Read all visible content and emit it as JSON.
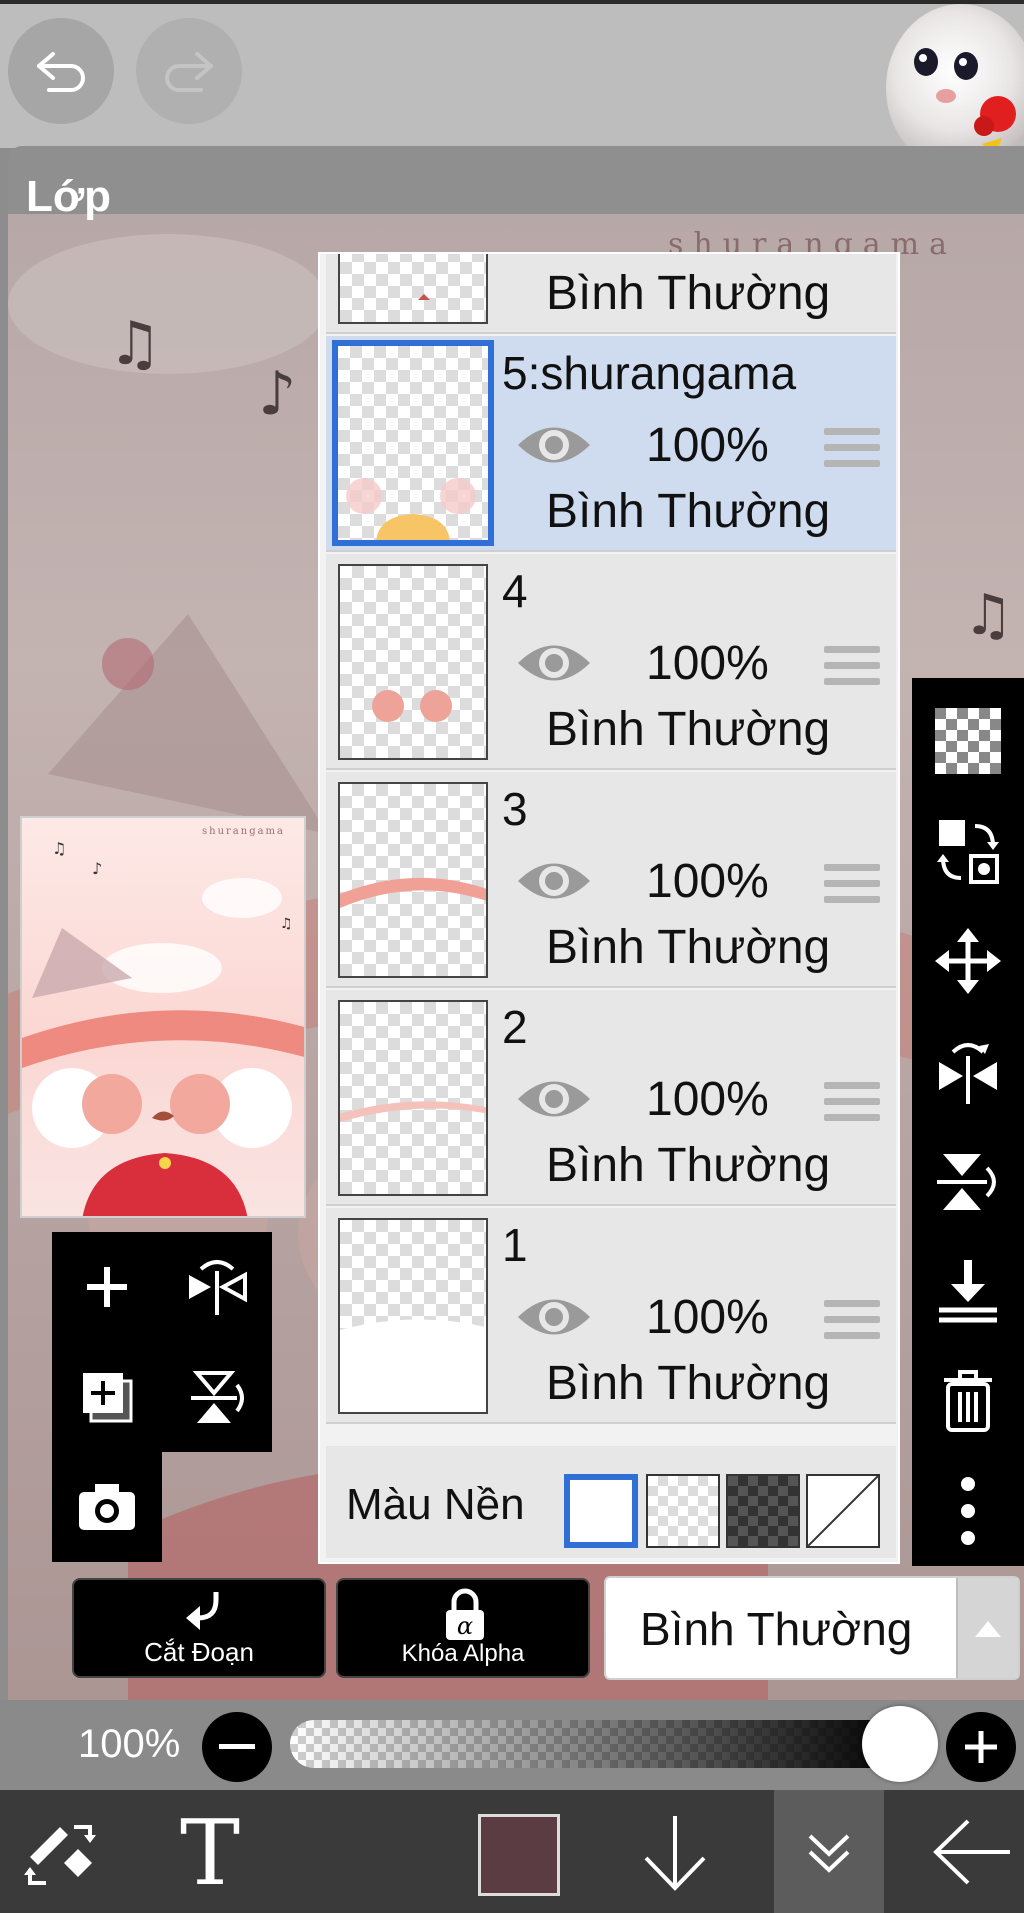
{
  "topbar": {
    "undo_icon": "undo-icon",
    "redo_icon": "redo-icon"
  },
  "panel": {
    "title": "Lớp"
  },
  "canvas": {
    "watermark": "shurangama"
  },
  "thumbnail": {
    "watermark": "shurangama"
  },
  "layers": [
    {
      "name": "",
      "opacity": "",
      "blend": "Bình Thường",
      "partial": true
    },
    {
      "name": "5:shurangama",
      "opacity": "100%",
      "blend": "Bình Thường",
      "selected": true
    },
    {
      "name": "4",
      "opacity": "100%",
      "blend": "Bình Thường"
    },
    {
      "name": "3",
      "opacity": "100%",
      "blend": "Bình Thường"
    },
    {
      "name": "2",
      "opacity": "100%",
      "blend": "Bình Thường"
    },
    {
      "name": "1",
      "opacity": "100%",
      "blend": "Bình Thường"
    }
  ],
  "background": {
    "label": "Màu Nền",
    "selected_option": "white"
  },
  "bottom_controls": {
    "clip_label": "Cắt Đoạn",
    "alpha_lock_label": "Khóa Alpha",
    "blend_mode_value": "Bình Thường"
  },
  "opacity_slider": {
    "value_text": "100%",
    "value": 1.0
  },
  "colors": {
    "current_color": "#5a3c42",
    "selected_accent": "#2f6fd6"
  }
}
